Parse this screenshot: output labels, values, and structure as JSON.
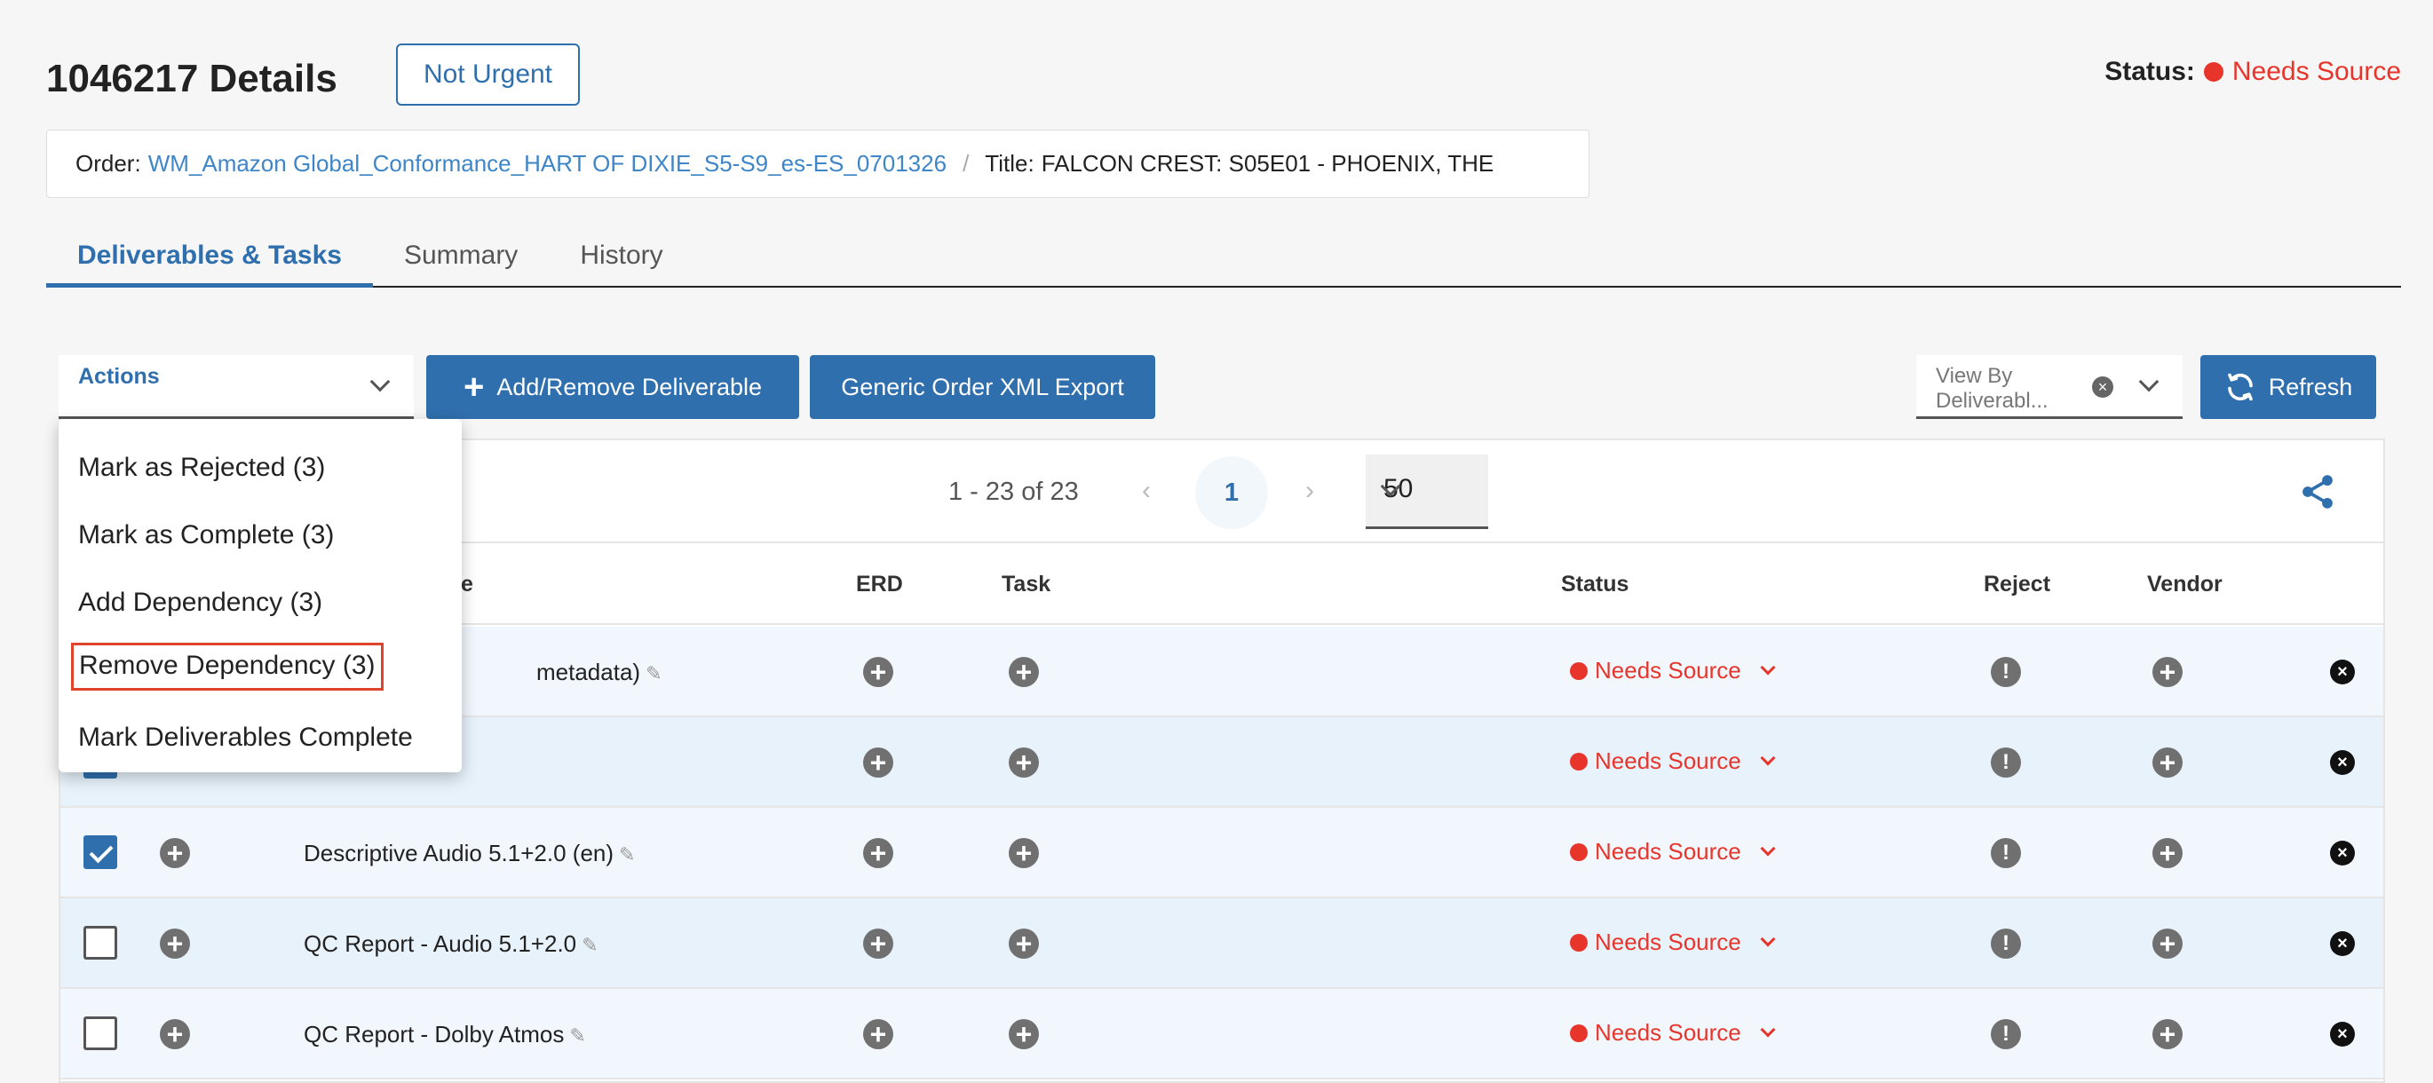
{
  "header": {
    "title": "1046217 Details",
    "urgency": "Not Urgent",
    "status_label": "Status:",
    "status_value": "Needs Source",
    "status_color": "#e8352c"
  },
  "breadcrumb": {
    "order_label": "Order:",
    "order_value": "WM_Amazon Global_Conformance_HART OF DIXIE_S5-S9_es-ES_0701326",
    "separator": "/",
    "title_label": "Title:",
    "title_value": "FALCON CREST: S05E01 - PHOENIX, THE"
  },
  "tabs": [
    {
      "label": "Deliverables & Tasks",
      "active": true
    },
    {
      "label": "Summary",
      "active": false
    },
    {
      "label": "History",
      "active": false
    }
  ],
  "toolbar": {
    "actions_label": "Actions",
    "add_remove_label": "Add/Remove Deliverable",
    "xml_export_label": "Generic Order XML Export",
    "viewby_line1": "View By",
    "viewby_line2": "Deliverabl...",
    "refresh_label": "Refresh",
    "accent_color": "#2f6fad"
  },
  "actions_menu": [
    {
      "label": "Mark as Rejected (3)"
    },
    {
      "label": "Mark as Complete (3)"
    },
    {
      "label": "Add Dependency (3)"
    },
    {
      "label": "Remove Dependency (3)",
      "highlighted": true
    },
    {
      "label": "Mark Deliverables Complete"
    }
  ],
  "pagination": {
    "range": "1 - 23 of 23",
    "prev": "‹",
    "current_page": "1",
    "next": "›",
    "per_page": "50"
  },
  "table": {
    "columns": {
      "title": "Title",
      "title_visible": "le",
      "erd": "ERD",
      "task": "Task",
      "status": "Status",
      "reject": "Reject",
      "vendor": "Vendor"
    },
    "rows": [
      {
        "title": "metadata)",
        "status": "Needs Source",
        "checked": null
      },
      {
        "title": "",
        "status": "Needs Source",
        "checked": true
      },
      {
        "title": "Descriptive Audio 5.1+2.0 (en)",
        "status": "Needs Source",
        "checked": true
      },
      {
        "title": "QC Report - Audio 5.1+2.0",
        "status": "Needs Source",
        "checked": false
      },
      {
        "title": "QC Report - Dolby Atmos",
        "status": "Needs Source",
        "checked": false
      }
    ]
  },
  "icons": {
    "plus": "+",
    "exclamation": "!",
    "close": "×",
    "pencil": "✎",
    "share": "share-icon",
    "refresh": "refresh-icon"
  }
}
